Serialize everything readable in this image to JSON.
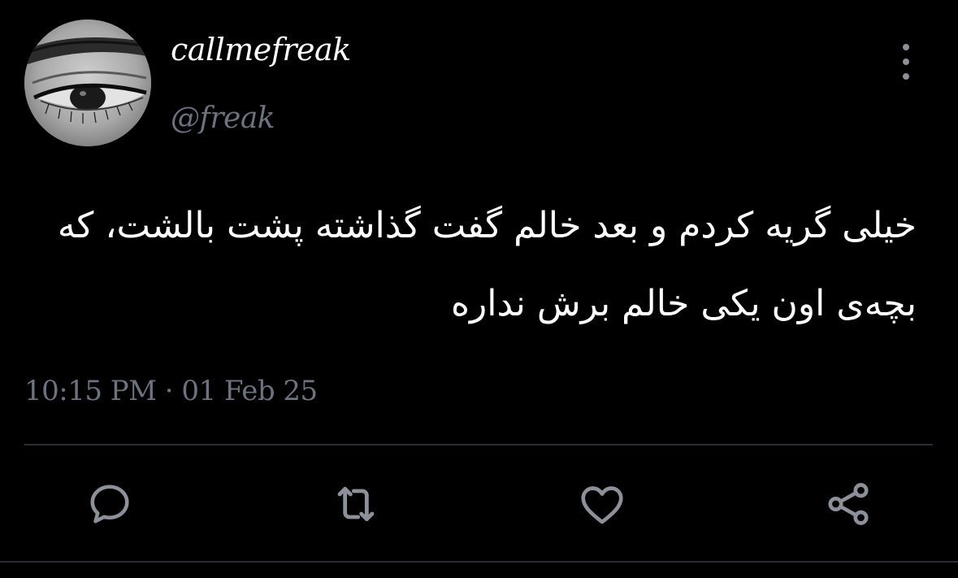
{
  "post": {
    "display_name": "callmefreak",
    "handle": "@freak",
    "text_line_1": "خیلی گریه کردم و بعد خالم گفت گذاشته پشت بالشت، که",
    "text_line_2": "بچه‌ی اون یکی خالم برش نداره",
    "timestamp": "10:15 PM · 01 Feb 25"
  },
  "actions": [
    {
      "icon": "reply-icon"
    },
    {
      "icon": "retweet-icon"
    },
    {
      "icon": "like-icon"
    },
    {
      "icon": "share-icon"
    }
  ],
  "colors": {
    "background": "#000000",
    "text": "#ffffff",
    "muted": "#6b7280",
    "icon": "#8b9099",
    "divider": "#2a2d31"
  }
}
